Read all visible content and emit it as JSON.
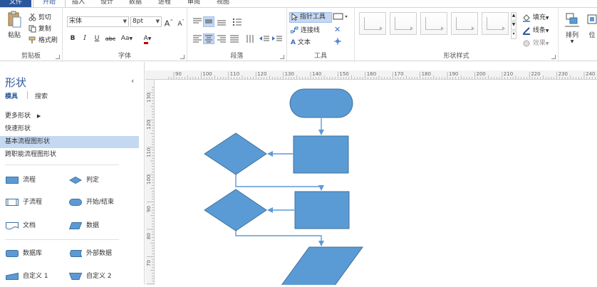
{
  "tabs": [
    "文件",
    "开始",
    "插入",
    "设计",
    "数据",
    "进程",
    "审阅",
    "视图"
  ],
  "clipboard": {
    "paste": "粘贴",
    "cut": "剪切",
    "copy": "复制",
    "format_painter": "格式刷",
    "group": "剪贴板"
  },
  "font": {
    "name": "宋体",
    "size": "8pt",
    "grow": "A",
    "shrink": "A",
    "bold": "B",
    "italic": "I",
    "underline": "U",
    "strike": "abc",
    "case": "Aa",
    "color": "A",
    "group": "字体"
  },
  "paragraph": {
    "group": "段落"
  },
  "tools": {
    "pointer": "指针工具",
    "connector": "连接线",
    "text": "文本",
    "group": "工具"
  },
  "shape_styles": {
    "group": "形状样式",
    "fill": "填充",
    "line": "线条",
    "effects": "效果"
  },
  "arrange": {
    "label": "排列",
    "position": "位"
  },
  "panel": {
    "title": "形状",
    "tab_stencils": "模具",
    "tab_search": "搜索",
    "menu": [
      "更多形状",
      "快速形状",
      "基本流程图形状",
      "跨职能流程图形状"
    ],
    "shapes": [
      {
        "label": "流程",
        "icon": "process-icon"
      },
      {
        "label": "判定",
        "icon": "decision-icon"
      },
      {
        "label": "子流程",
        "icon": "subprocess-icon"
      },
      {
        "label": "开始/结束",
        "icon": "start-end-icon"
      },
      {
        "label": "文档",
        "icon": "document-icon"
      },
      {
        "label": "数据",
        "icon": "data-icon"
      },
      {
        "label": "数据库",
        "icon": "database-icon"
      },
      {
        "label": "外部数据",
        "icon": "external-data-icon"
      },
      {
        "label": "自定义 1",
        "icon": "custom1-icon"
      },
      {
        "label": "自定义 2",
        "icon": "custom2-icon"
      }
    ]
  },
  "ruler": {
    "h_labels": [
      "90",
      "100",
      "110",
      "120",
      "130",
      "140",
      "150",
      "160",
      "170",
      "180",
      "190",
      "200",
      "210",
      "220",
      "230",
      "240"
    ],
    "v_labels": [
      "130",
      "120",
      "110",
      "100",
      "90",
      "80",
      "70"
    ]
  },
  "colors": {
    "accent": "#2b579a",
    "shape_fill": "#5b9bd5",
    "shape_stroke": "#41719c",
    "selected_bg": "#c5d8f1"
  }
}
